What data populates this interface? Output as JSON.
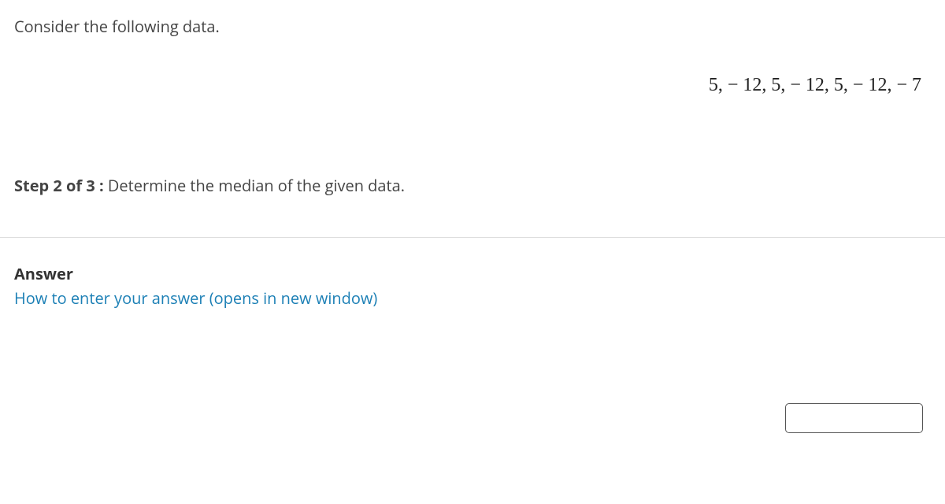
{
  "prompt": "Consider the following data.",
  "data_values": [
    5,
    -12,
    5,
    -12,
    5,
    -12,
    -7
  ],
  "data_display": "5, − 12, 5, − 12, 5, − 12, − 7",
  "step": {
    "label": "Step 2 of 3 :",
    "text": "  Determine the median of the given data."
  },
  "answer": {
    "heading": "Answer",
    "link_text": "How to enter your answer (opens in new window)",
    "input_value": ""
  }
}
